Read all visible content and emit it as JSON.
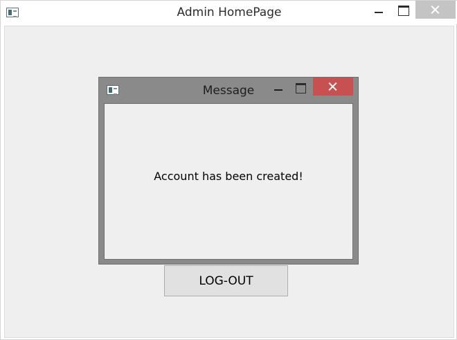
{
  "main_window": {
    "title": "Admin HomePage",
    "app_icon": "application-icon",
    "controls": {
      "minimize": "minimize-icon",
      "maximize": "maximize-icon",
      "close": "close-icon"
    },
    "logout_label": "LOG-OUT"
  },
  "message_dialog": {
    "title": "Message",
    "app_icon": "application-icon",
    "controls": {
      "minimize": "minimize-icon",
      "maximize": "maximize-icon",
      "close": "close-icon"
    },
    "text": "Account has been created!"
  },
  "colors": {
    "dialog_close_button": "#c75050",
    "main_close_button": "#c4c4c4",
    "dialog_frame": "#8a8a8a",
    "client_background": "#efefef"
  }
}
